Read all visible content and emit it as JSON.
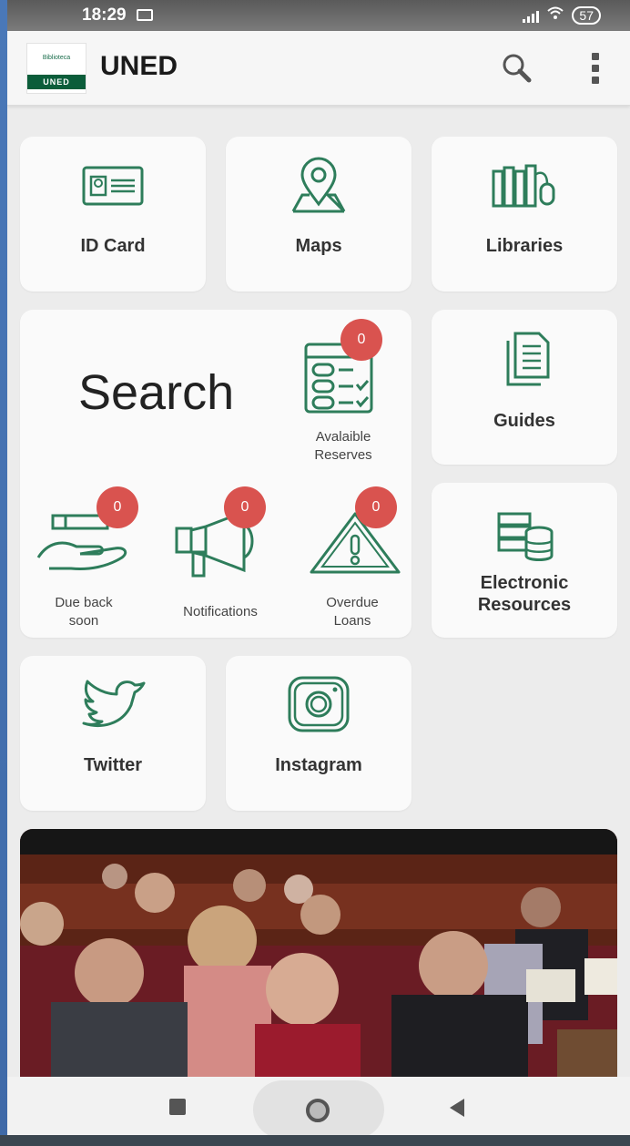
{
  "status_bar": {
    "time": "18:29",
    "battery": "57",
    "icons": [
      "message-icon",
      "signal-icon",
      "wifi-icon",
      "battery-icon"
    ]
  },
  "app_bar": {
    "logo_top_text": "Biblioteca",
    "logo_bottom_text": "UNED",
    "title": "UNED",
    "icons": [
      "search-icon",
      "more-vert-icon"
    ]
  },
  "tiles": {
    "id_card": {
      "label": "ID Card",
      "icon": "id-card-icon"
    },
    "maps": {
      "label": "Maps",
      "icon": "map-pin-icon"
    },
    "libraries": {
      "label": "Libraries",
      "icon": "library-icon"
    },
    "guides": {
      "label": "Guides",
      "icon": "document-icon"
    },
    "electronic": {
      "label_line1": "Electronic",
      "label_line2": "Resources",
      "icon": "database-icon"
    },
    "twitter": {
      "label": "Twitter",
      "icon": "twitter-icon"
    },
    "instagram": {
      "label": "Instagram",
      "icon": "instagram-icon"
    }
  },
  "search_panel": {
    "title": "Search",
    "reserves": {
      "label_line1": "Avalaible",
      "label_line2": "Reserves",
      "count": "0",
      "icon": "checklist-icon"
    },
    "due_back": {
      "label_line1": "Due back",
      "label_line2": "soon",
      "count": "0",
      "icon": "hand-book-icon"
    },
    "notifications": {
      "label": "Notifications",
      "count": "0",
      "icon": "megaphone-icon"
    },
    "overdue": {
      "label_line1": "Overdue",
      "label_line2": "Loans",
      "count": "0",
      "icon": "warning-icon"
    }
  },
  "colors": {
    "icon_green": "#2e7d5b",
    "badge_red": "#d9534f",
    "card_bg": "#fafafa",
    "screen_bg": "#ececec"
  },
  "nav_bar": {
    "icons": [
      "recent-apps-icon",
      "home-icon",
      "back-icon"
    ]
  }
}
